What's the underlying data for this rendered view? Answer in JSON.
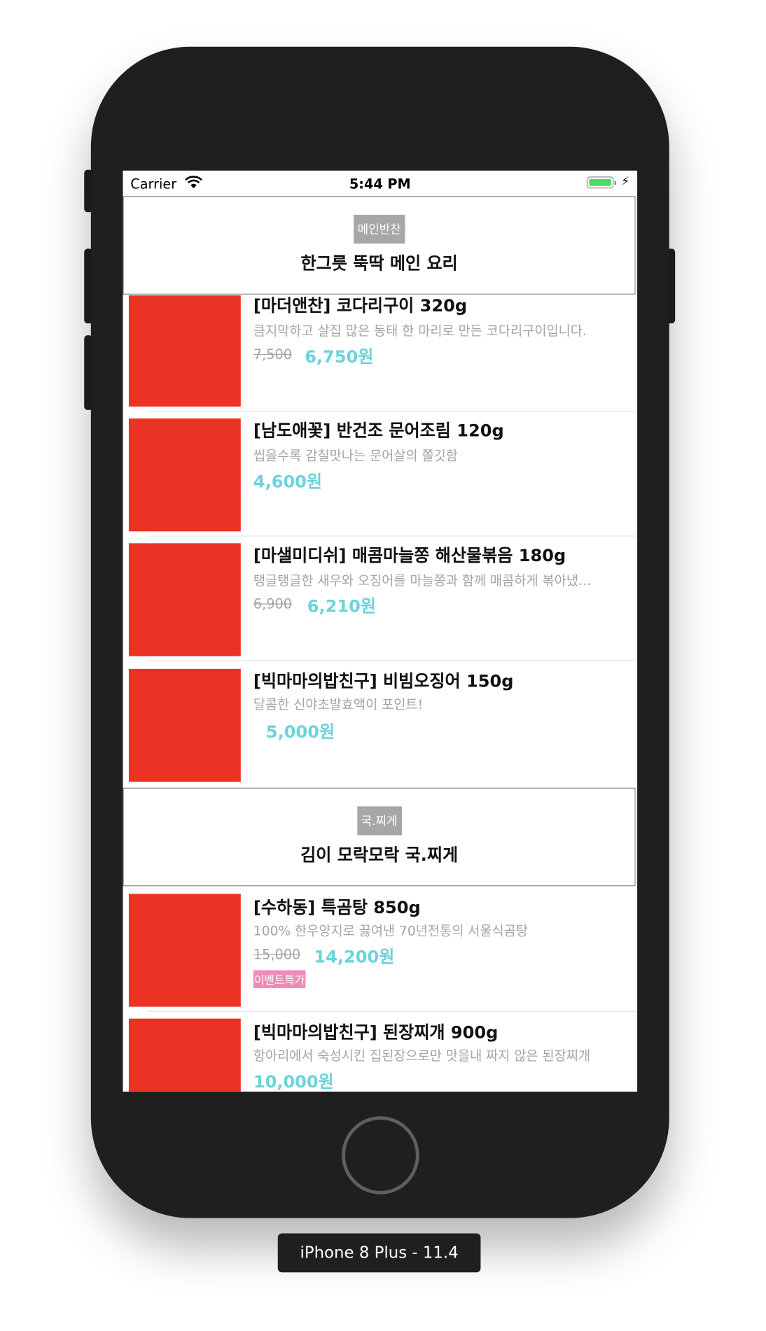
{
  "status_bar": {
    "carrier": "Carrier",
    "time": "5:44 PM",
    "battery_level": 1.0,
    "charging": true
  },
  "sections": [
    {
      "badge": "메인반찬",
      "title": "한그릇 뚝딱 메인 요리",
      "items": [
        {
          "title": "[마더앤찬] 코다리구이 320g",
          "description": "큼지막하고 살집 많은 동태 한 마리로 만든 코다리구이입니다.",
          "old_price": "7,500",
          "price": "6,750원"
        },
        {
          "title": "[남도애꽃] 반건조 문어조림 120g",
          "description": "씹을수록 감칠맛나는 문어살의 쫄깃함",
          "old_price": "",
          "price": "4,600원"
        },
        {
          "title": "[마샐미디쉬] 매콤마늘쫑 해산물볶음 180g",
          "description": "탱글탱글한 새우와 오징어를 마늘쫑과 함께 매콤하게 볶아냈…",
          "old_price": "6,900",
          "price": "6,210원"
        },
        {
          "title": "[빅마마의밥친구] 비빔오징어 150g",
          "description": "달콤한 신야초발효액이 포인트!",
          "old_price": "",
          "price": "5,000원"
        }
      ]
    },
    {
      "badge": "국.찌게",
      "title": "김이 모락모락 국.찌게",
      "items": [
        {
          "title": "[수하동] 특곰탕 850g",
          "description": "100% 한우양지로 끓여낸 70년전통의 서울식곰탕",
          "old_price": "15,000",
          "price": "14,200원",
          "tag": "이벤트특가"
        },
        {
          "title": "[빅마마의밥친구] 된장찌개 900g",
          "description": "항아리에서 숙성시킨 집된장으로만 맛을내 짜지 않은 된장찌개",
          "old_price": "",
          "price": "10,000원"
        }
      ]
    }
  ],
  "simulator_label": "iPhone 8 Plus - 11.4",
  "colors": {
    "thumbnail": "#eb3325",
    "price": "#6cd3db",
    "badge": "#a7a7a7",
    "event_tag": "#ef8bb6",
    "device": "#1f1f1f"
  }
}
